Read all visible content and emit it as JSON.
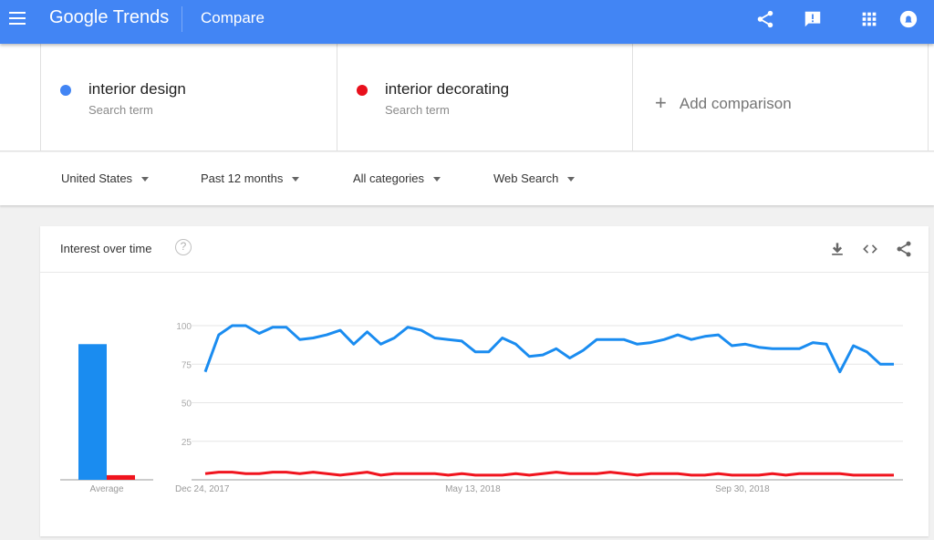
{
  "app": {
    "logo": "Google Trends",
    "page_title": "Compare",
    "icons": [
      "menu-icon",
      "share-icon",
      "feedback-icon",
      "apps-icon",
      "account-icon"
    ]
  },
  "terms": [
    {
      "name": "interior design",
      "sub": "Search term",
      "color": "#4285f4"
    },
    {
      "name": "interior decorating",
      "sub": "Search term",
      "color": "#e8101c"
    }
  ],
  "add_comparison": {
    "icon": "+",
    "label": "Add comparison"
  },
  "filters": [
    {
      "label": "United States"
    },
    {
      "label": "Past 12 months"
    },
    {
      "label": "All categories"
    },
    {
      "label": "Web Search"
    }
  ],
  "card": {
    "title": "Interest over time",
    "help": "?",
    "icons": [
      "download-icon",
      "embed-icon",
      "share-icon"
    ]
  },
  "chart_data": {
    "type": "line",
    "title": "Interest over time",
    "ylim": [
      0,
      100
    ],
    "yticks": [
      25,
      50,
      75,
      100
    ],
    "ytick_labels": [
      "25",
      "50",
      "75",
      "100"
    ],
    "xtick_labels": [
      {
        "label": "Dec 24, 2017",
        "index": 0
      },
      {
        "label": "May 13, 2018",
        "index": 20
      },
      {
        "label": "Sep 30, 2018",
        "index": 40
      }
    ],
    "grid": true,
    "average_label": "Average",
    "series": [
      {
        "name": "interior design",
        "color": "#1a8cf0",
        "average": 88,
        "values": [
          70,
          94,
          100,
          100,
          95,
          99,
          99,
          91,
          92,
          94,
          97,
          88,
          96,
          88,
          92,
          99,
          97,
          92,
          91,
          90,
          83,
          83,
          92,
          88,
          80,
          81,
          85,
          79,
          84,
          91,
          91,
          91,
          88,
          89,
          91,
          94,
          91,
          93,
          94,
          87,
          88,
          86,
          85,
          85,
          85,
          89,
          88,
          70,
          87,
          83,
          75,
          75
        ]
      },
      {
        "name": "interior decorating",
        "color": "#f0141e",
        "average": 3,
        "values": [
          4,
          5,
          5,
          4,
          4,
          5,
          5,
          4,
          5,
          4,
          3,
          4,
          5,
          3,
          4,
          4,
          4,
          4,
          3,
          4,
          3,
          3,
          3,
          4,
          3,
          4,
          5,
          4,
          4,
          4,
          5,
          4,
          3,
          4,
          4,
          4,
          3,
          3,
          4,
          3,
          3,
          3,
          4,
          3,
          4,
          4,
          4,
          4,
          3,
          3,
          3,
          3
        ]
      }
    ]
  }
}
